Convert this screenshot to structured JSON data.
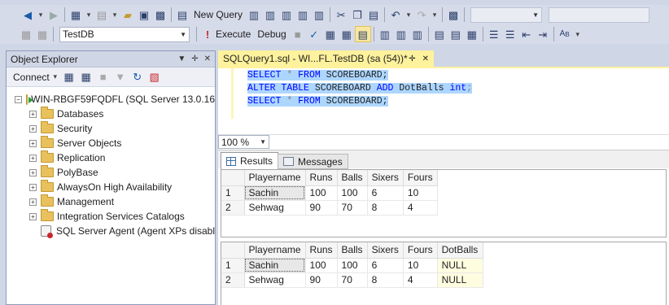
{
  "toolbar1": {
    "new_query_label": "New Query"
  },
  "toolbar2": {
    "database": "TestDB",
    "execute_label": "Execute",
    "debug_label": "Debug"
  },
  "object_explorer": {
    "title": "Object Explorer",
    "connect_label": "Connect",
    "server": "WIN-RBGF59FQDFL (SQL Server 13.0.16",
    "nodes": [
      {
        "label": "Databases"
      },
      {
        "label": "Security"
      },
      {
        "label": "Server Objects"
      },
      {
        "label": "Replication"
      },
      {
        "label": "PolyBase"
      },
      {
        "label": "AlwaysOn High Availability"
      },
      {
        "label": "Management"
      },
      {
        "label": "Integration Services Catalogs"
      }
    ],
    "agent": "SQL Server Agent (Agent XPs disabl"
  },
  "editor": {
    "tab_title": "SQLQuery1.sql - WI...FL.TestDB (sa (54))*",
    "lines": [
      {
        "kw1": "SELECT",
        "op": " * ",
        "kw2": "FROM",
        "rest": " SCOREBOARD;"
      },
      {
        "kw1": "ALTER TABLE",
        "op": " SCOREBOARD ",
        "kw2": "ADD",
        "rest": " DotBalls ",
        "kw3": "int",
        "tail": ";"
      },
      {
        "kw1": "SELECT",
        "op": " * ",
        "kw2": "FROM",
        "rest": " SCOREBOARD;"
      }
    ],
    "zoom": "100 %"
  },
  "results": {
    "tabs": {
      "results": "Results",
      "messages": "Messages"
    },
    "grid1": {
      "columns": [
        "Playername",
        "Runs",
        "Balls",
        "Sixers",
        "Fours"
      ],
      "rows": [
        {
          "n": "1",
          "cells": [
            "Sachin",
            "100",
            "100",
            "6",
            "10"
          ]
        },
        {
          "n": "2",
          "cells": [
            "Sehwag",
            "90",
            "70",
            "8",
            "4"
          ]
        }
      ]
    },
    "grid2": {
      "columns": [
        "Playername",
        "Runs",
        "Balls",
        "Sixers",
        "Fours",
        "DotBalls"
      ],
      "rows": [
        {
          "n": "1",
          "cells": [
            "Sachin",
            "100",
            "100",
            "6",
            "10",
            "NULL"
          ]
        },
        {
          "n": "2",
          "cells": [
            "Sehwag",
            "90",
            "70",
            "8",
            "4",
            "NULL"
          ]
        }
      ]
    }
  },
  "colors": {
    "tab_active": "#fff29d",
    "selection": "#add6ff",
    "keyword": "#0000ff",
    "null_cell": "#fffde0"
  }
}
